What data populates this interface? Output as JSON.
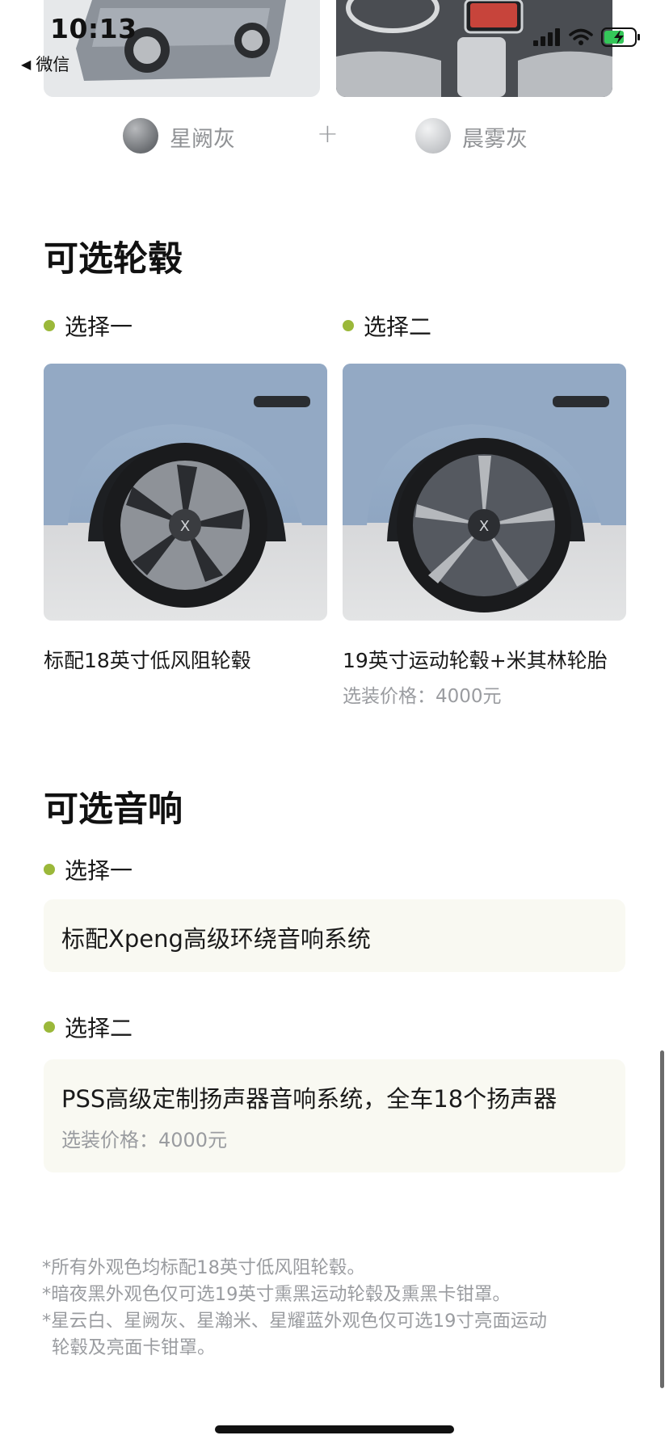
{
  "status_bar": {
    "time": "10:13",
    "back_app": "微信"
  },
  "exterior_color": {
    "name": "星阙灰",
    "color": "#7a7d81"
  },
  "interior_color": {
    "name": "晨雾灰",
    "color": "#c4c6c9"
  },
  "plus": "+",
  "wheels": {
    "title": "可选轮毂",
    "options": [
      {
        "label": "选择一",
        "caption": "标配18英寸低风阻轮毂",
        "price": ""
      },
      {
        "label": "选择二",
        "caption": "19英寸运动轮毂+米其林轮胎",
        "price": "选装价格：4000元"
      }
    ]
  },
  "audio": {
    "title": "可选音响",
    "options": [
      {
        "label": "选择一",
        "text": "标配Xpeng高级环绕音响系统",
        "price": ""
      },
      {
        "label": "选择二",
        "text": "PSS高级定制扬声器音响系统，全车18个扬声器",
        "price": "选装价格：4000元"
      }
    ]
  },
  "notes": [
    "*所有外观色均标配18英寸低风阻轮毂。",
    "*暗夜黑外观色仅可选19英寸熏黑运动轮毂及熏黑卡钳罩。",
    "*星云白、星阙灰、星瀚米、星耀蓝外观色仅可选19寸亮面运动",
    "轮毂及亮面卡钳罩。"
  ],
  "colors": {
    "accent_dot": "#9bb83a",
    "card_bg": "#f9f9f2",
    "muted_text": "#9a9ca0"
  }
}
